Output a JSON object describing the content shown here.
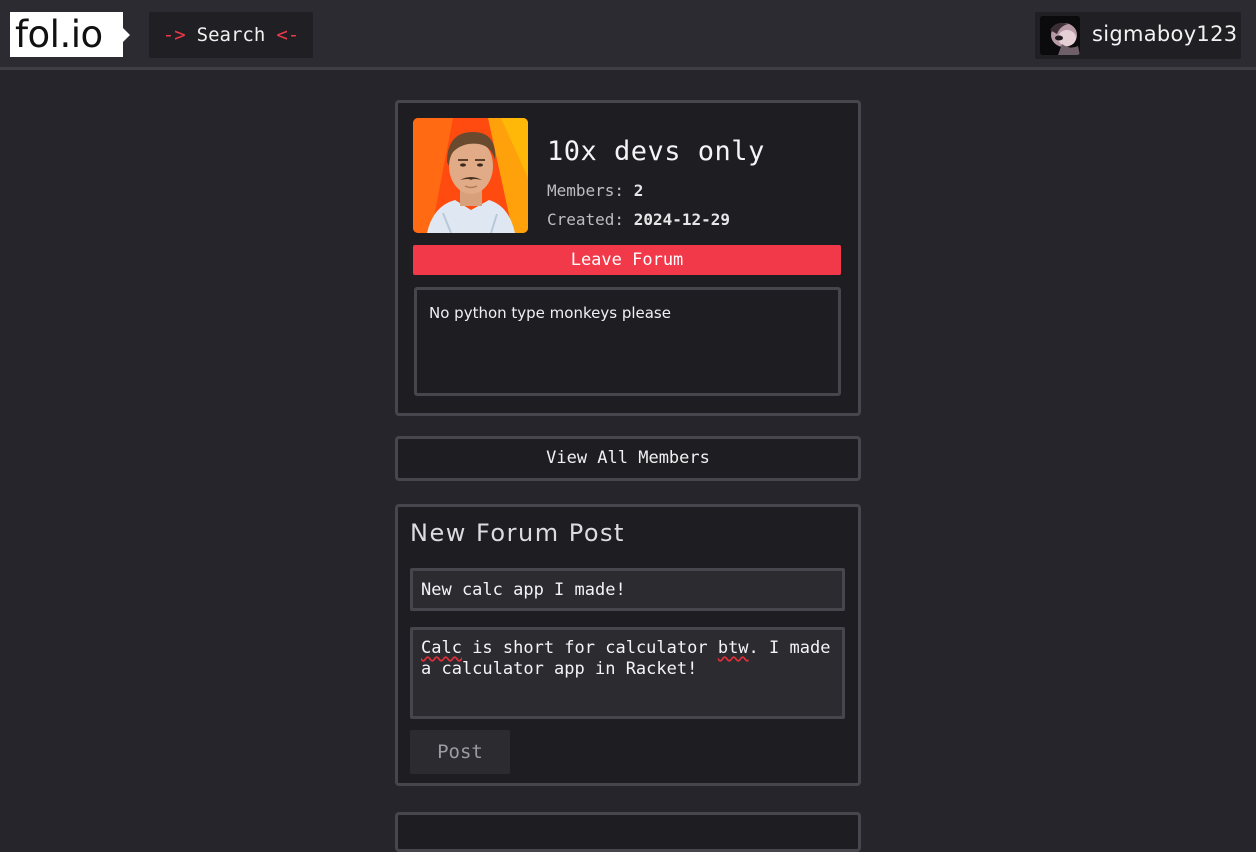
{
  "header": {
    "logo_text": "fol.io",
    "search_prefix": "->",
    "search_label": "Search",
    "search_suffix": "<-",
    "username": "sigmaboy123"
  },
  "forum": {
    "title": "10x devs only",
    "members_label": "Members:",
    "members_value": "2",
    "created_label": "Created:",
    "created_value": "2024-12-29",
    "leave_label": "Leave Forum",
    "description": "No python type monkeys please"
  },
  "members_button_label": "View All Members",
  "new_post": {
    "heading": "New Forum Post",
    "title_value": "New calc app I made!",
    "body_word_1": "Calc",
    "body_part_2": " is short for calculator ",
    "body_word_3": "btw",
    "body_part_4": ". I made\na calculator app in Racket!",
    "post_label": "Post"
  },
  "colors": {
    "accent_red": "#f2394a",
    "background": "#25252b",
    "card": "#1e1e22"
  },
  "icons": {
    "user_avatar": "avatar-image",
    "forum_image": "forum-image"
  }
}
